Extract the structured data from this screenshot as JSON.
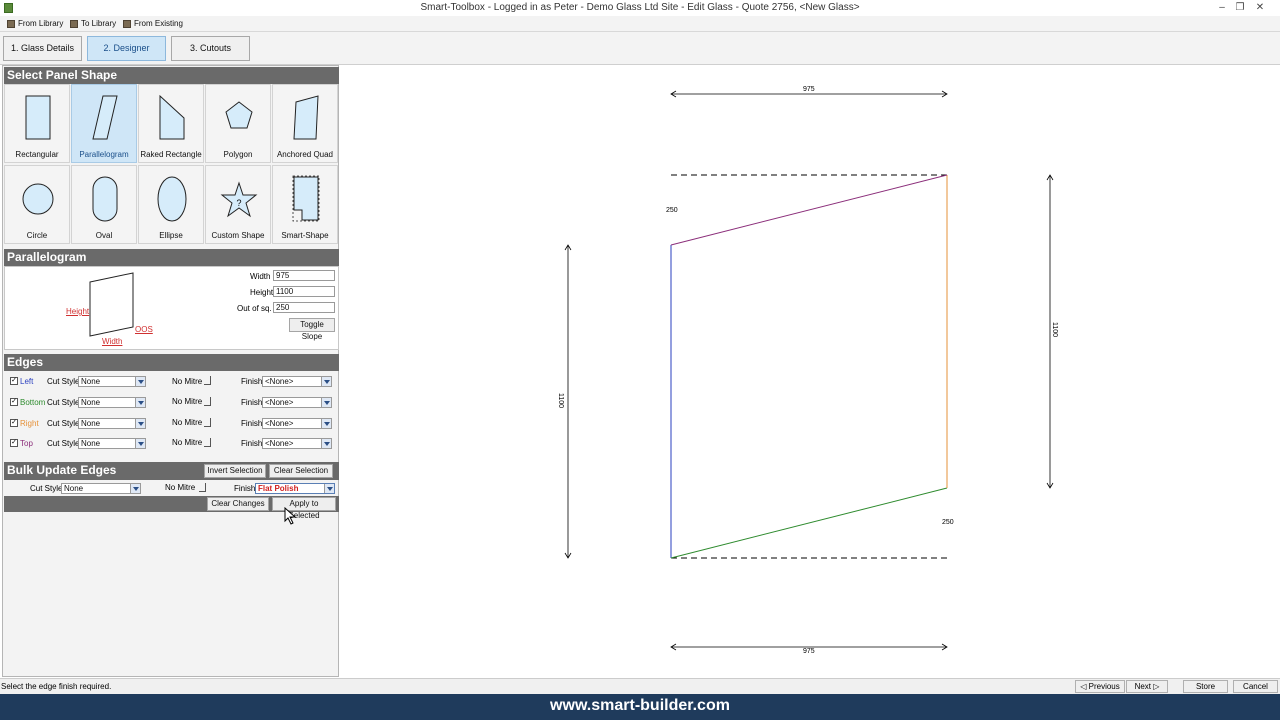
{
  "window": {
    "title": "Smart-Toolbox - Logged in as Peter - Demo Glass Ltd Site - Edit Glass - Quote 2756, <New Glass>",
    "minimize_icon": "minimize-icon",
    "restore_icon": "restore-icon",
    "close_icon": "close-icon"
  },
  "toolbar": {
    "from_library": "From Library",
    "to_library": "To Library",
    "from_existing": "From Existing"
  },
  "tabs": [
    {
      "label": "1. Glass Details",
      "active": false
    },
    {
      "label": "2. Designer",
      "active": true
    },
    {
      "label": "3. Cutouts",
      "active": false
    }
  ],
  "select_panel_shape": {
    "header": "Select Panel Shape",
    "shapes": [
      {
        "label": "Rectangular",
        "icon": "rectangle-icon"
      },
      {
        "label": "Parallelogram",
        "icon": "parallelogram-icon",
        "selected": true
      },
      {
        "label": "Raked Rectangle",
        "icon": "raked-rectangle-icon"
      },
      {
        "label": "Polygon",
        "icon": "pentagon-icon"
      },
      {
        "label": "Anchored Quad",
        "icon": "anchored-quad-icon"
      },
      {
        "label": "Circle",
        "icon": "circle-icon"
      },
      {
        "label": "Oval",
        "icon": "oval-icon"
      },
      {
        "label": "Ellipse",
        "icon": "ellipse-icon"
      },
      {
        "label": "Custom Shape",
        "icon": "star-icon"
      },
      {
        "label": "Smart-Shape",
        "icon": "smart-shape-icon"
      }
    ]
  },
  "parallelogram": {
    "header": "Parallelogram",
    "diagram_height": "Height",
    "diagram_width": "Width",
    "diagram_oos": "OOS",
    "width_label": "Width",
    "width_value": "975",
    "height_label": "Height",
    "height_value": "1100",
    "oos_label": "Out of sq.",
    "oos_value": "250",
    "toggle_slope": "Toggle Slope"
  },
  "edges": {
    "header": "Edges",
    "cut_style_label": "Cut Style",
    "no_mitre_label": "No Mitre",
    "finish_label": "Finish",
    "rows": [
      {
        "name": "Left",
        "color": "#2a3fbf",
        "checked": "✓",
        "cut_style": "None",
        "finish": "<None>"
      },
      {
        "name": "Bottom",
        "color": "#2e8b2e",
        "checked": "✓",
        "cut_style": "None",
        "finish": "<None>"
      },
      {
        "name": "Right",
        "color": "#e69138",
        "checked": "✓",
        "cut_style": "None",
        "finish": "<None>"
      },
      {
        "name": "Top",
        "color": "#8b2e7a",
        "checked": "✓",
        "cut_style": "None",
        "finish": "<None>"
      }
    ]
  },
  "bulk_update": {
    "header": "Bulk Update Edges",
    "invert_selection": "Invert Selection",
    "clear_selection": "Clear Selection",
    "cut_style_label": "Cut Style",
    "cut_style_value": "None",
    "no_mitre_label": "No Mitre",
    "finish_label": "Finish",
    "finish_value": "Flat Polish",
    "clear_changes": "Clear Changes",
    "apply_to_selected": "Apply to Selected"
  },
  "drawing": {
    "top_width": "975",
    "bottom_width": "975",
    "left_height": "1100",
    "right_height": "1100",
    "top_oos": "250",
    "bottom_oos": "250",
    "colors": {
      "left": "#2a3fbf",
      "bottom": "#2e8b2e",
      "right": "#e69138",
      "top": "#8b2e7a"
    }
  },
  "status": {
    "message": "Select the edge finish required.",
    "previous": "Previous",
    "next": "Next",
    "store": "Store",
    "cancel": "Cancel"
  },
  "footer": {
    "text": "www.smart-builder.com"
  }
}
